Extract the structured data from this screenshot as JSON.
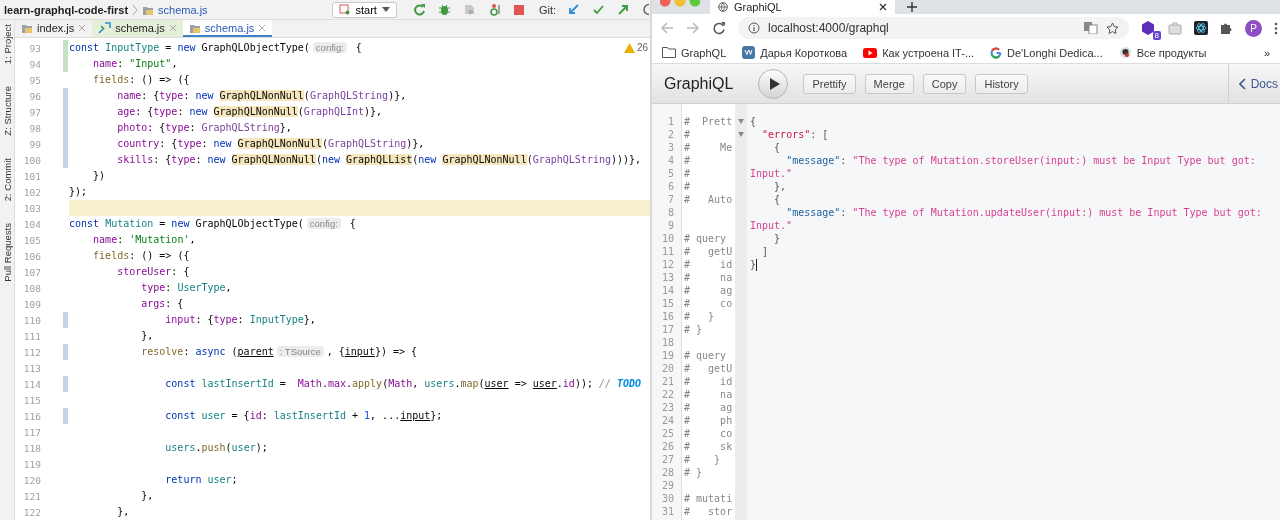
{
  "ide": {
    "project": "learn-graphql-code-first",
    "breadcrumb": "schema.js",
    "run_config": "start",
    "git_label": "Git:",
    "side_tools": [
      {
        "label": "1: Project"
      },
      {
        "label": "Z: Structure"
      },
      {
        "label": "2: Commit"
      },
      {
        "label": "Pull Requests"
      }
    ],
    "tabs": [
      {
        "label": "index.js",
        "kind": "js",
        "selected": false
      },
      {
        "label": "schema.js",
        "kind": "test",
        "selected": false
      },
      {
        "label": "schema.js",
        "kind": "js",
        "selected": true
      }
    ],
    "warning_count": "26",
    "lines": [
      {
        "no": "93",
        "added": true,
        "modified": false,
        "current": false,
        "segs": [
          {
            "kind": "kw",
            "text": "const "
          },
          {
            "kind": "id",
            "text": "InputType"
          },
          {
            "kind": "plain",
            "text": " = "
          },
          {
            "kind": "kw",
            "text": "new "
          },
          {
            "kind": "plain",
            "text": "GraphQLObjectType("
          },
          {
            "kind": "hint",
            "text": "config:"
          },
          {
            "kind": "plain",
            "text": " {"
          }
        ]
      },
      {
        "no": "94",
        "added": true,
        "modified": false,
        "current": false,
        "segs": [
          {
            "kind": "prop",
            "text": "    name"
          },
          {
            "kind": "plain",
            "text": ": "
          },
          {
            "kind": "str",
            "text": "\"Input\""
          },
          {
            "kind": "plain",
            "text": ","
          }
        ]
      },
      {
        "no": "95",
        "added": false,
        "modified": false,
        "current": false,
        "segs": [
          {
            "kind": "method",
            "text": "    fields"
          },
          {
            "kind": "plain",
            "text": ": () => ({"
          }
        ]
      },
      {
        "no": "96",
        "added": false,
        "modified": true,
        "current": false,
        "segs": [
          {
            "kind": "prop",
            "text": "        name"
          },
          {
            "kind": "plain",
            "text": ": {"
          },
          {
            "kind": "prop",
            "text": "type"
          },
          {
            "kind": "plain",
            "text": ": "
          },
          {
            "kind": "kw",
            "text": "new "
          },
          {
            "kind": "hl",
            "text": "GraphQLNonNull"
          },
          {
            "kind": "plain",
            "text": "("
          },
          {
            "kind": "gql",
            "text": "GraphQLString"
          },
          {
            "kind": "plain",
            "text": ")},"
          }
        ]
      },
      {
        "no": "97",
        "added": false,
        "modified": true,
        "current": false,
        "segs": [
          {
            "kind": "prop",
            "text": "        age"
          },
          {
            "kind": "plain",
            "text": ": {"
          },
          {
            "kind": "prop",
            "text": "type"
          },
          {
            "kind": "plain",
            "text": ": "
          },
          {
            "kind": "kw",
            "text": "new "
          },
          {
            "kind": "hl",
            "text": "GraphQLNonNull"
          },
          {
            "kind": "plain",
            "text": "("
          },
          {
            "kind": "gql",
            "text": "GraphQLInt"
          },
          {
            "kind": "plain",
            "text": ")},"
          }
        ]
      },
      {
        "no": "98",
        "added": false,
        "modified": true,
        "current": false,
        "segs": [
          {
            "kind": "prop",
            "text": "        photo"
          },
          {
            "kind": "plain",
            "text": ": {"
          },
          {
            "kind": "prop",
            "text": "type"
          },
          {
            "kind": "plain",
            "text": ": "
          },
          {
            "kind": "gql",
            "text": "GraphQLString"
          },
          {
            "kind": "plain",
            "text": "},"
          }
        ]
      },
      {
        "no": "99",
        "added": false,
        "modified": true,
        "current": false,
        "segs": [
          {
            "kind": "prop",
            "text": "        country"
          },
          {
            "kind": "plain",
            "text": ": {"
          },
          {
            "kind": "prop",
            "text": "type"
          },
          {
            "kind": "plain",
            "text": ": "
          },
          {
            "kind": "kw",
            "text": "new "
          },
          {
            "kind": "hl",
            "text": "GraphQLNonNull"
          },
          {
            "kind": "plain",
            "text": "("
          },
          {
            "kind": "gql",
            "text": "GraphQLString"
          },
          {
            "kind": "plain",
            "text": ")},"
          }
        ]
      },
      {
        "no": "100",
        "added": false,
        "modified": true,
        "current": false,
        "segs": [
          {
            "kind": "prop",
            "text": "        skills"
          },
          {
            "kind": "plain",
            "text": ": {"
          },
          {
            "kind": "prop",
            "text": "type"
          },
          {
            "kind": "plain",
            "text": ": "
          },
          {
            "kind": "kw",
            "text": "new "
          },
          {
            "kind": "hl",
            "text": "GraphQLNonNull"
          },
          {
            "kind": "plain",
            "text": "("
          },
          {
            "kind": "kw",
            "text": "new "
          },
          {
            "kind": "hl",
            "text": "GraphQLList"
          },
          {
            "kind": "plain",
            "text": "("
          },
          {
            "kind": "kw",
            "text": "new "
          },
          {
            "kind": "hl",
            "text": "GraphQLNonNull"
          },
          {
            "kind": "plain",
            "text": "("
          },
          {
            "kind": "gql",
            "text": "GraphQLString"
          },
          {
            "kind": "plain",
            "text": ")))},"
          }
        ]
      },
      {
        "no": "101",
        "added": false,
        "modified": false,
        "current": false,
        "segs": [
          {
            "kind": "plain",
            "text": "    })"
          }
        ]
      },
      {
        "no": "102",
        "added": false,
        "modified": false,
        "current": false,
        "segs": [
          {
            "kind": "plain",
            "text": "});"
          }
        ]
      },
      {
        "no": "103",
        "added": false,
        "modified": false,
        "current": true
      },
      {
        "no": "104",
        "added": false,
        "modified": false,
        "current": false,
        "segs": [
          {
            "kind": "kw",
            "text": "const "
          },
          {
            "kind": "id",
            "text": "Mutation"
          },
          {
            "kind": "plain",
            "text": " = "
          },
          {
            "kind": "kw",
            "text": "new "
          },
          {
            "kind": "plain",
            "text": "GraphQLObjectType("
          },
          {
            "kind": "hint",
            "text": "config:"
          },
          {
            "kind": "plain",
            "text": " {"
          }
        ]
      },
      {
        "no": "105",
        "added": false,
        "modified": false,
        "current": false,
        "segs": [
          {
            "kind": "prop",
            "text": "    name"
          },
          {
            "kind": "plain",
            "text": ": "
          },
          {
            "kind": "str",
            "text": "'Mutation'"
          },
          {
            "kind": "plain",
            "text": ","
          }
        ]
      },
      {
        "no": "106",
        "added": false,
        "modified": false,
        "current": false,
        "segs": [
          {
            "kind": "method",
            "text": "    fields"
          },
          {
            "kind": "plain",
            "text": ": () => ({"
          }
        ]
      },
      {
        "no": "107",
        "added": false,
        "modified": false,
        "current": false,
        "segs": [
          {
            "kind": "prop",
            "text": "        storeUser"
          },
          {
            "kind": "plain",
            "text": ": {"
          }
        ]
      },
      {
        "no": "108",
        "added": false,
        "modified": false,
        "current": false,
        "segs": [
          {
            "kind": "prop",
            "text": "            type"
          },
          {
            "kind": "plain",
            "text": ": "
          },
          {
            "kind": "id",
            "text": "UserType"
          },
          {
            "kind": "plain",
            "text": ","
          }
        ]
      },
      {
        "no": "109",
        "added": false,
        "modified": false,
        "current": false,
        "segs": [
          {
            "kind": "prop",
            "text": "            args"
          },
          {
            "kind": "plain",
            "text": ": {"
          }
        ]
      },
      {
        "no": "110",
        "added": false,
        "modified": true,
        "current": false,
        "segs": [
          {
            "kind": "prop",
            "text": "                input"
          },
          {
            "kind": "plain",
            "text": ": {"
          },
          {
            "kind": "prop",
            "text": "type"
          },
          {
            "kind": "plain",
            "text": ": "
          },
          {
            "kind": "id",
            "text": "InputType"
          },
          {
            "kind": "plain",
            "text": "},"
          }
        ]
      },
      {
        "no": "111",
        "added": false,
        "modified": false,
        "current": false,
        "segs": [
          {
            "kind": "plain",
            "text": "            },"
          }
        ]
      },
      {
        "no": "112",
        "added": false,
        "modified": true,
        "current": false,
        "segs": [
          {
            "kind": "method",
            "text": "            resolve"
          },
          {
            "kind": "plain",
            "text": ": "
          },
          {
            "kind": "kw",
            "text": "async "
          },
          {
            "kind": "plain",
            "text": "("
          },
          {
            "kind": "under",
            "text": "parent"
          },
          {
            "kind": "hint",
            "text": ": TSource"
          },
          {
            "kind": "plain",
            "text": ", {"
          },
          {
            "kind": "under",
            "text": "input"
          },
          {
            "kind": "plain",
            "text": "}) => {"
          }
        ]
      },
      {
        "no": "113",
        "added": false,
        "modified": false,
        "current": false
      },
      {
        "no": "114",
        "added": false,
        "modified": true,
        "current": false,
        "segs": [
          {
            "kind": "kw",
            "text": "                const "
          },
          {
            "kind": "id",
            "text": "lastInsertId"
          },
          {
            "kind": "plain",
            "text": " =  "
          },
          {
            "kind": "prop",
            "text": "Math"
          },
          {
            "kind": "plain",
            "text": "."
          },
          {
            "kind": "prop",
            "text": "max"
          },
          {
            "kind": "plain",
            "text": "."
          },
          {
            "kind": "method",
            "text": "apply"
          },
          {
            "kind": "plain",
            "text": "("
          },
          {
            "kind": "prop",
            "text": "Math"
          },
          {
            "kind": "plain",
            "text": ", "
          },
          {
            "kind": "id",
            "text": "users"
          },
          {
            "kind": "plain",
            "text": "."
          },
          {
            "kind": "method",
            "text": "map"
          },
          {
            "kind": "plain",
            "text": "("
          },
          {
            "kind": "under",
            "text": "user"
          },
          {
            "kind": "plain",
            "text": " => "
          },
          {
            "kind": "under",
            "text": "user"
          },
          {
            "kind": "plain",
            "text": "."
          },
          {
            "kind": "prop",
            "text": "id"
          },
          {
            "kind": "plain",
            "text": ")); "
          },
          {
            "kind": "cm",
            "text": "//"
          },
          {
            "kind": "todo",
            "text": " TODO"
          }
        ]
      },
      {
        "no": "115",
        "added": false,
        "modified": false,
        "current": false
      },
      {
        "no": "116",
        "added": false,
        "modified": true,
        "current": false,
        "segs": [
          {
            "kind": "kw",
            "text": "                const "
          },
          {
            "kind": "id",
            "text": "user"
          },
          {
            "kind": "plain",
            "text": " = {"
          },
          {
            "kind": "prop",
            "text": "id"
          },
          {
            "kind": "plain",
            "text": ": "
          },
          {
            "kind": "id",
            "text": "lastInsertId"
          },
          {
            "kind": "plain",
            "text": " + "
          },
          {
            "kind": "num",
            "text": "1"
          },
          {
            "kind": "plain",
            "text": ", ..."
          },
          {
            "kind": "under",
            "text": "input"
          },
          {
            "kind": "plain",
            "text": "};"
          }
        ]
      },
      {
        "no": "117",
        "added": false,
        "modified": false,
        "current": false
      },
      {
        "no": "118",
        "added": false,
        "modified": false,
        "current": false,
        "segs": [
          {
            "kind": "id",
            "text": "                users"
          },
          {
            "kind": "plain",
            "text": "."
          },
          {
            "kind": "method",
            "text": "push"
          },
          {
            "kind": "plain",
            "text": "("
          },
          {
            "kind": "id",
            "text": "user"
          },
          {
            "kind": "plain",
            "text": ");"
          }
        ]
      },
      {
        "no": "119",
        "added": false,
        "modified": false,
        "current": false
      },
      {
        "no": "120",
        "added": false,
        "modified": false,
        "current": false,
        "segs": [
          {
            "kind": "kw",
            "text": "                return "
          },
          {
            "kind": "id",
            "text": "user"
          },
          {
            "kind": "plain",
            "text": ";"
          }
        ]
      },
      {
        "no": "121",
        "added": false,
        "modified": false,
        "current": false,
        "segs": [
          {
            "kind": "plain",
            "text": "            },"
          }
        ]
      },
      {
        "no": "122",
        "added": false,
        "modified": false,
        "current": false,
        "segs": [
          {
            "kind": "plain",
            "text": "        },"
          }
        ]
      }
    ]
  },
  "browser": {
    "tab_title": "GraphiQL",
    "url": "localhost:4000/graphql",
    "extension_badge": "8",
    "profile_initial": "P",
    "bookmarks": [
      {
        "label": "GraphQL",
        "kind": "folder"
      },
      {
        "label": "Дарья Короткова",
        "kind": "vk"
      },
      {
        "label": "Как устроена IT-...",
        "kind": "youtube"
      },
      {
        "label": "De'Longhi Dedica...",
        "kind": "google"
      },
      {
        "label": "Все продукты",
        "kind": "penguin"
      }
    ],
    "bookmarks_more": "»"
  },
  "graphiql": {
    "logo": "GraphiQL",
    "buttons": [
      "Prettify",
      "Merge",
      "Copy",
      "History"
    ],
    "docs": "Docs",
    "query_lines": [
      {
        "no": "1",
        "text": "#  Prett"
      },
      {
        "no": "2",
        "text": "#"
      },
      {
        "no": "3",
        "text": "#     Me"
      },
      {
        "no": "4",
        "text": "#"
      },
      {
        "no": "5",
        "text": "#"
      },
      {
        "no": "6",
        "text": "#"
      },
      {
        "no": "7",
        "text": "#   Auto"
      },
      {
        "no": "8"
      },
      {
        "no": "9"
      },
      {
        "no": "10",
        "text": "# query"
      },
      {
        "no": "11",
        "text": "#   getU"
      },
      {
        "no": "12",
        "text": "#     id"
      },
      {
        "no": "13",
        "text": "#     na"
      },
      {
        "no": "14",
        "text": "#     ag"
      },
      {
        "no": "15",
        "text": "#     co"
      },
      {
        "no": "16",
        "text": "#   }"
      },
      {
        "no": "17",
        "text": "# }"
      },
      {
        "no": "18"
      },
      {
        "no": "19",
        "text": "# query"
      },
      {
        "no": "20",
        "text": "#   getU"
      },
      {
        "no": "21",
        "text": "#     id"
      },
      {
        "no": "22",
        "text": "#     na"
      },
      {
        "no": "23",
        "text": "#     ag"
      },
      {
        "no": "24",
        "text": "#     ph"
      },
      {
        "no": "25",
        "text": "#     co"
      },
      {
        "no": "26",
        "text": "#     sk"
      },
      {
        "no": "27",
        "text": "#    }"
      },
      {
        "no": "28",
        "text": "# }"
      },
      {
        "no": "29"
      },
      {
        "no": "30",
        "text": "# mutati"
      },
      {
        "no": "31",
        "text": "#   stor"
      }
    ],
    "result_lines": [
      {
        "foldable": true,
        "cursor": false,
        "segs": [
          {
            "kind": "punc",
            "text": "{"
          }
        ]
      },
      {
        "foldable": true,
        "cursor": false,
        "segs": [
          {
            "kind": "errkey",
            "text": "  \"errors\""
          },
          {
            "kind": "punc",
            "text": ": ["
          }
        ]
      },
      {
        "foldable": false,
        "cursor": false,
        "segs": [
          {
            "kind": "punc",
            "text": "    {"
          }
        ]
      },
      {
        "foldable": false,
        "cursor": false,
        "segs": [
          {
            "kind": "key",
            "text": "      \"message\""
          },
          {
            "kind": "punc",
            "text": ": "
          },
          {
            "kind": "str",
            "text": "\"The type of Mutation.storeUser(input:) must be Input Type but got: Input.\""
          }
        ]
      },
      {
        "foldable": false,
        "cursor": false,
        "segs": [
          {
            "kind": "punc",
            "text": "    },"
          }
        ]
      },
      {
        "foldable": false,
        "cursor": false,
        "segs": [
          {
            "kind": "punc",
            "text": "    {"
          }
        ]
      },
      {
        "foldable": false,
        "cursor": false,
        "segs": [
          {
            "kind": "key",
            "text": "      \"message\""
          },
          {
            "kind": "punc",
            "text": ": "
          },
          {
            "kind": "str",
            "text": "\"The type of Mutation.updateUser(input:) must be Input Type but got: Input.\""
          }
        ]
      },
      {
        "foldable": false,
        "cursor": false,
        "segs": [
          {
            "kind": "punc",
            "text": "    }"
          }
        ]
      },
      {
        "foldable": false,
        "cursor": false,
        "segs": [
          {
            "kind": "punc",
            "text": "  ]"
          }
        ]
      },
      {
        "foldable": false,
        "cursor": true,
        "segs": [
          {
            "kind": "punc",
            "text": "}"
          }
        ]
      }
    ]
  }
}
